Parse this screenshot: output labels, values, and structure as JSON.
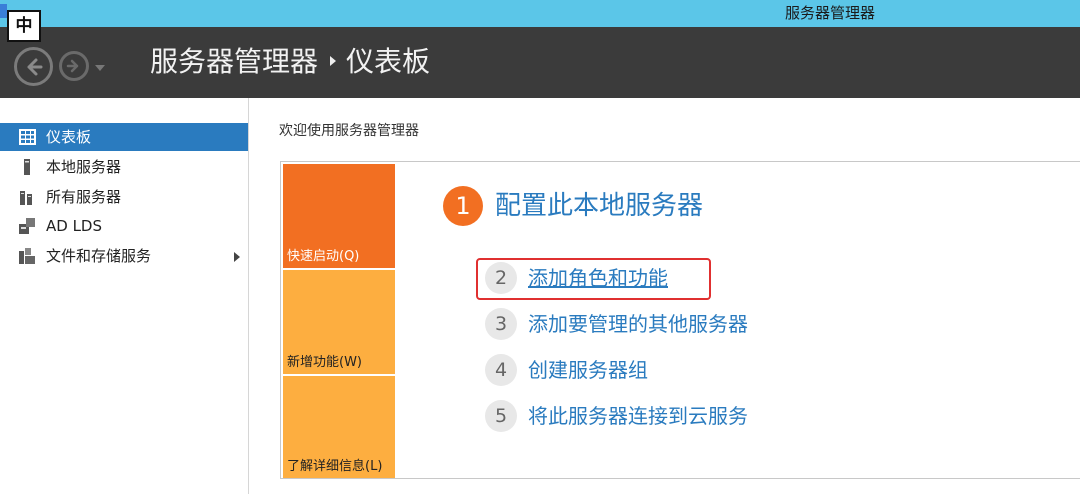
{
  "window": {
    "title": "服务器管理器"
  },
  "ime": {
    "label": "中"
  },
  "header": {
    "breadcrumb": {
      "root": "服务器管理器",
      "current": "仪表板"
    }
  },
  "sidebar": {
    "items": [
      {
        "label": "仪表板",
        "icon": "dashboard-icon",
        "active": true
      },
      {
        "label": "本地服务器",
        "icon": "server-icon",
        "active": false
      },
      {
        "label": "所有服务器",
        "icon": "servers-icon",
        "active": false
      },
      {
        "label": "AD LDS",
        "icon": "ad-lds-icon",
        "active": false
      },
      {
        "label": "文件和存储服务",
        "icon": "file-storage-icon",
        "active": false,
        "has_submenu": true
      }
    ]
  },
  "main": {
    "welcome_title": "欢迎使用服务器管理器",
    "tiles": [
      {
        "label": "快速启动(Q)",
        "color": "#f26f22"
      },
      {
        "label": "新增功能(W)",
        "color": "#fdae40"
      },
      {
        "label": "了解详细信息(L)",
        "color": "#fdae40"
      }
    ],
    "steps": [
      {
        "num": "1",
        "label": "配置此本地服务器"
      },
      {
        "num": "2",
        "label": "添加角色和功能"
      },
      {
        "num": "3",
        "label": "添加要管理的其他服务器"
      },
      {
        "num": "4",
        "label": "创建服务器组"
      },
      {
        "num": "5",
        "label": "将此服务器连接到云服务"
      }
    ]
  },
  "colors": {
    "accent": "#2a7bbf",
    "orange": "#f26f22",
    "light_orange": "#fdae40",
    "titlebar": "#5bc6e8",
    "header": "#3b3b3b",
    "highlight": "#e03030"
  }
}
